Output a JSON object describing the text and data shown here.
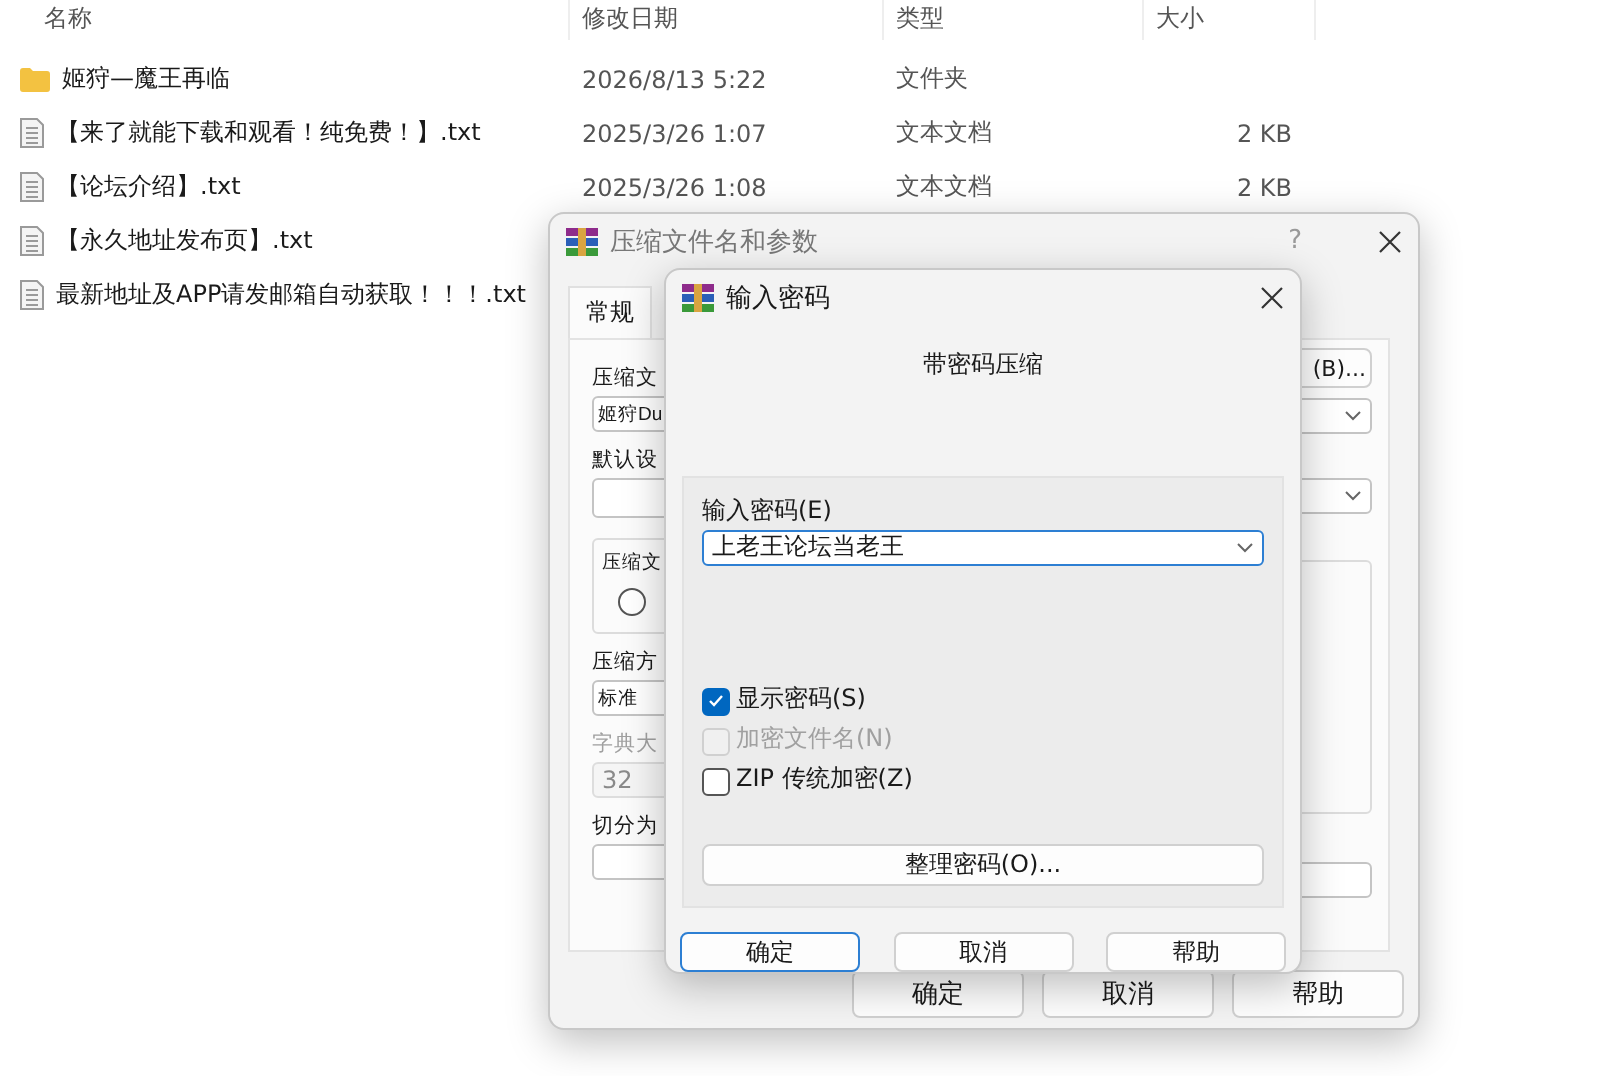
{
  "explorer": {
    "columns": [
      "名称",
      "修改日期",
      "类型",
      "大小"
    ],
    "rows": [
      {
        "kind": "folder",
        "name": "姬狩—魔王再临",
        "modified": "2026/8/13 5:22",
        "type": "文件夹"
      },
      {
        "kind": "file",
        "name": "【来了就能下载和观看！纯免费！】.txt",
        "modified": "2025/3/26 1:07",
        "type": "文本文档",
        "size": "2 KB"
      },
      {
        "kind": "file",
        "name": "【论坛介绍】.txt",
        "modified": "2025/3/26 1:08",
        "type": "文本文档",
        "size": "2 KB"
      },
      {
        "kind": "file",
        "name": "【永久地址发布页】.txt"
      },
      {
        "kind": "file",
        "name": "最新地址及APP请发邮箱自动获取！！！.txt"
      }
    ]
  },
  "archive_dialog": {
    "title": "压缩文件名和参数",
    "help": "?",
    "tabs": [
      {
        "label": "常规",
        "selected": true
      }
    ],
    "left_items": [
      {
        "kind": "label",
        "text": "压缩文",
        "disabled": false
      },
      {
        "kind": "combo",
        "value": "姬狩Du",
        "disabled": false
      },
      {
        "kind": "label",
        "text": "默认设",
        "disabled": false
      },
      {
        "kind": "combo",
        "disabled": false
      },
      {
        "kind": "group",
        "text": "压缩文",
        "radio_selected": false
      },
      {
        "kind": "label",
        "text": "压缩方",
        "disabled": false
      },
      {
        "kind": "combo",
        "value": "标准",
        "disabled": false
      },
      {
        "kind": "label",
        "text": "字典大",
        "disabled": true
      },
      {
        "kind": "field",
        "value": "32",
        "disabled": true
      },
      {
        "kind": "label",
        "text": "切分为",
        "disabled": false
      },
      {
        "kind": "field",
        "disabled": false
      }
    ],
    "right_items": [
      {
        "kind": "button",
        "text": "(B)..."
      },
      {
        "kind": "combo"
      },
      {
        "kind": "combo"
      },
      {
        "kind": "group"
      },
      {
        "kind": "field"
      }
    ],
    "buttons": [
      "确定",
      "取消",
      "帮助"
    ]
  },
  "password_dialog": {
    "title": "输入密码",
    "subtitle": "带密码压缩",
    "password_label": "输入密码(E)",
    "password_value": "上老王论坛当老王",
    "checkboxes": [
      {
        "label": "显示密码(S)",
        "checked": true,
        "disabled": false
      },
      {
        "label": "加密文件名(N)",
        "checked": false,
        "disabled": true
      },
      {
        "label": "ZIP 传统加密(Z)",
        "checked": false,
        "disabled": false
      }
    ],
    "manage_button": "整理密码(O)...",
    "buttons": [
      {
        "label": "确定",
        "default": true
      },
      {
        "label": "取消",
        "default": false
      },
      {
        "label": "帮助",
        "default": false
      }
    ]
  }
}
